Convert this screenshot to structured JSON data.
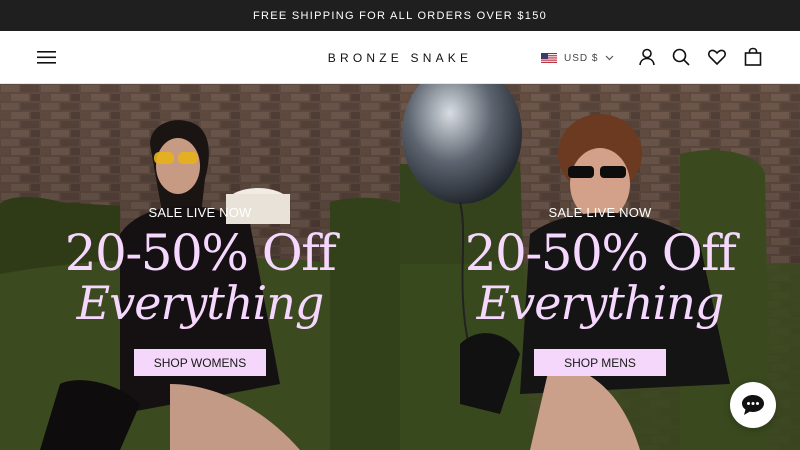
{
  "announcement": {
    "text": "FREE SHIPPING FOR ALL ORDERS OVER $150"
  },
  "header": {
    "logo": "BRONZE SNAKE",
    "currency": "USD $",
    "icons": [
      "menu-icon",
      "flag-us-icon",
      "chevron-down-icon",
      "account-icon",
      "search-icon",
      "wishlist-heart-icon",
      "cart-bag-icon"
    ]
  },
  "hero": {
    "left": {
      "eyebrow": "SALE LIVE NOW",
      "headline": "20-50% Off",
      "headline_italic": "Everything",
      "cta": "SHOP WOMENS"
    },
    "right": {
      "eyebrow": "SALE LIVE NOW",
      "headline": "20-50% Off",
      "headline_italic": "Everything",
      "cta": "SHOP MENS"
    }
  },
  "chat": {
    "icon": "chat-bubble-icon"
  },
  "colors": {
    "announcement_bg": "#1f1f1f",
    "headline": "#f6d8ff",
    "cta_bg": "#f4d7fa",
    "sofa_green": "#3b4a1f",
    "brick": "#6b5548"
  }
}
